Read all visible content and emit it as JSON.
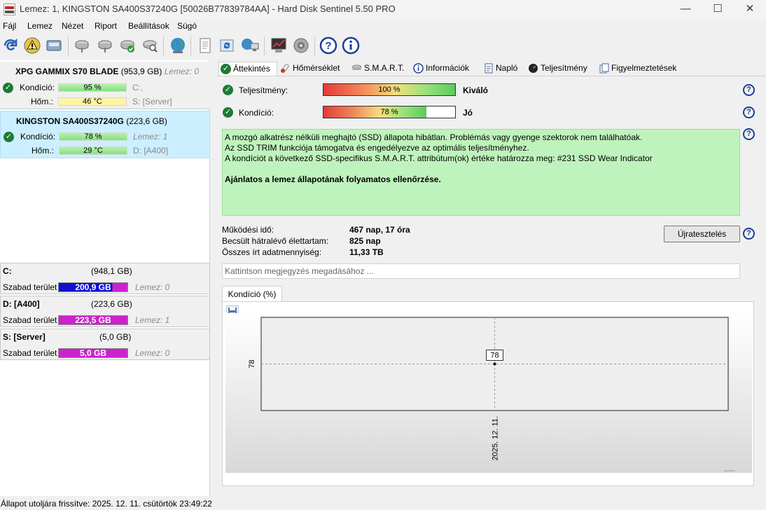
{
  "window": {
    "title": "Lemez: 1, KINGSTON SA400S37240G [50026B77839784AA]  -  Hard Disk Sentinel 5.50 PRO",
    "minimize": "—",
    "maximize": "☐",
    "close": "✕"
  },
  "menu": [
    "Fájl",
    "Lemez",
    "Nézet",
    "Riport",
    "Beállítások",
    "Súgó"
  ],
  "disks": [
    {
      "name": "XPG GAMMIX S70 BLADE",
      "size": "(953,9 GB)",
      "lemez": "Lemez: 0",
      "kondicio_label": "Kondíció:",
      "kondicio": "95 %",
      "kondicio_pct": 95,
      "hom_label": "Hőm.:",
      "hom": "46 °C",
      "drive_a": "C:,",
      "drive_b": "S: [Server]"
    },
    {
      "name": "KINGSTON SA400S37240G",
      "size": "(223,6 GB)",
      "lemez": "Lemez: 1",
      "kondicio_label": "Kondíció:",
      "kondicio": "78 %",
      "kondicio_pct": 78,
      "hom_label": "Hőm.:",
      "hom": "29 °C",
      "drive_a": "D: [A400]",
      "drive_b": ""
    }
  ],
  "volumes": [
    {
      "name": "C:",
      "size": "(948,1 GB)",
      "free_label": "Szabad terület",
      "free": "200,9 GB",
      "lemez": "Lemez: 0"
    },
    {
      "name": "D: [A400]",
      "size": "(223,6 GB)",
      "free_label": "Szabad terület",
      "free": "223,5 GB",
      "lemez": "Lemez: 1"
    },
    {
      "name": "S: [Server]",
      "size": "(5,0 GB)",
      "free_label": "Szabad terület",
      "free": "5,0 GB",
      "lemez": "Lemez: 0"
    }
  ],
  "tabs": [
    "Áttekintés",
    "Hőmérséklet",
    "S.M.A.R.T.",
    "Információk",
    "Napló",
    "Teljesítmény",
    "Figyelmeztetések"
  ],
  "overview": {
    "perf_label": "Teljesítmény:",
    "perf_value": "100 %",
    "perf_pct": 100,
    "perf_rating": "Kiváló",
    "cond_label": "Kondíció:",
    "cond_value": "78 %",
    "cond_pct": 78,
    "cond_rating": "Jó",
    "info_line1": "A mozgó alkatrész nélküli meghajtó (SSD) állapota hibátlan. Problémás vagy gyenge szektorok nem találhatóak.",
    "info_line2": "Az SSD TRIM funkciója támogatva és engedélyezve az optimális teljesítményhez.",
    "info_line3": "A kondíciót a következő SSD-specifikus S.M.A.R.T. attribútum(ok) értéke határozza meg:  #231 SSD Wear Indicator",
    "info_bold": "Ajánlatos a lemez állapotának folyamatos ellenőrzése.",
    "uptime_label": "Működési idő:",
    "uptime": "467 nap, 17 óra",
    "remaining_label": "Becsült hátralévő élettartam:",
    "remaining": "825 nap",
    "written_label": "Összes írt adatmennyiség:",
    "written": "11,33 TB",
    "retest_button": "Újratesztelés",
    "note_placeholder": "Kattintson megjegyzés megadásához ..."
  },
  "help_glyph": "?",
  "chart_tab": "Kondíció  (%)",
  "chart_data": {
    "type": "line",
    "title": "",
    "x": [
      "2025. 12. 11."
    ],
    "series": [
      {
        "values": [
          78
        ]
      }
    ],
    "y_tick_labels": [
      "78"
    ],
    "data_labels": [
      "78"
    ]
  },
  "status": "Állapot utoljára frissítve: 2025. 12. 11. csütörtök 23:49:22",
  "colors": {
    "accent_blue": "#1c3f95",
    "info_green": "#bff3bd",
    "volume_blue": "#1010d0",
    "volume_magenta": "#cc22cc",
    "selected_row": "#ccefff"
  }
}
